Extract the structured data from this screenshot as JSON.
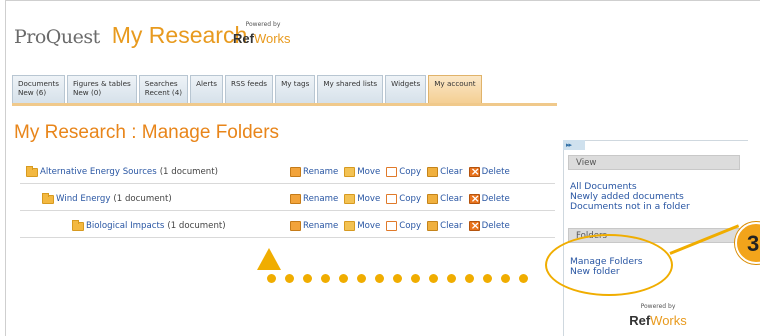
{
  "header": {
    "brand": "ProQuest",
    "app_title": "My Research",
    "powered_by": "Powered by",
    "refworks_ref": "Ref",
    "refworks_works": "Works"
  },
  "tabs": [
    {
      "label": "Documents",
      "sub": "New (6)"
    },
    {
      "label": "Figures & tables",
      "sub": "New (0)"
    },
    {
      "label": "Searches",
      "sub": "Recent (4)"
    },
    {
      "label": "Alerts",
      "sub": ""
    },
    {
      "label": "RSS feeds",
      "sub": ""
    },
    {
      "label": "My tags",
      "sub": ""
    },
    {
      "label": "My shared lists",
      "sub": ""
    },
    {
      "label": "Widgets",
      "sub": ""
    },
    {
      "label": "My account",
      "sub": ""
    }
  ],
  "page_title": "My Research : Manage Folders",
  "folders": [
    {
      "name": "Alternative Energy Sources",
      "count": "(1 document)"
    },
    {
      "name": "Wind Energy",
      "count": "(1 document)"
    },
    {
      "name": "Biological Impacts",
      "count": "(1 document)"
    }
  ],
  "actions": {
    "rename": "Rename",
    "move": "Move",
    "copy": "Copy",
    "clear": "Clear",
    "delete": "Delete"
  },
  "panel": {
    "toggle": "▸▸",
    "view_heading": "View",
    "view_links": [
      "All Documents",
      "Newly added documents",
      "Documents not in a folder"
    ],
    "folders_heading": "Folders",
    "folder_links": [
      "Manage Folders",
      "New folder"
    ]
  },
  "callout": {
    "number": "3",
    "color": "#f0ad00"
  },
  "colors": {
    "accent": "#e8851a",
    "link": "#2956a3",
    "active_tab": "#f4cf94"
  }
}
